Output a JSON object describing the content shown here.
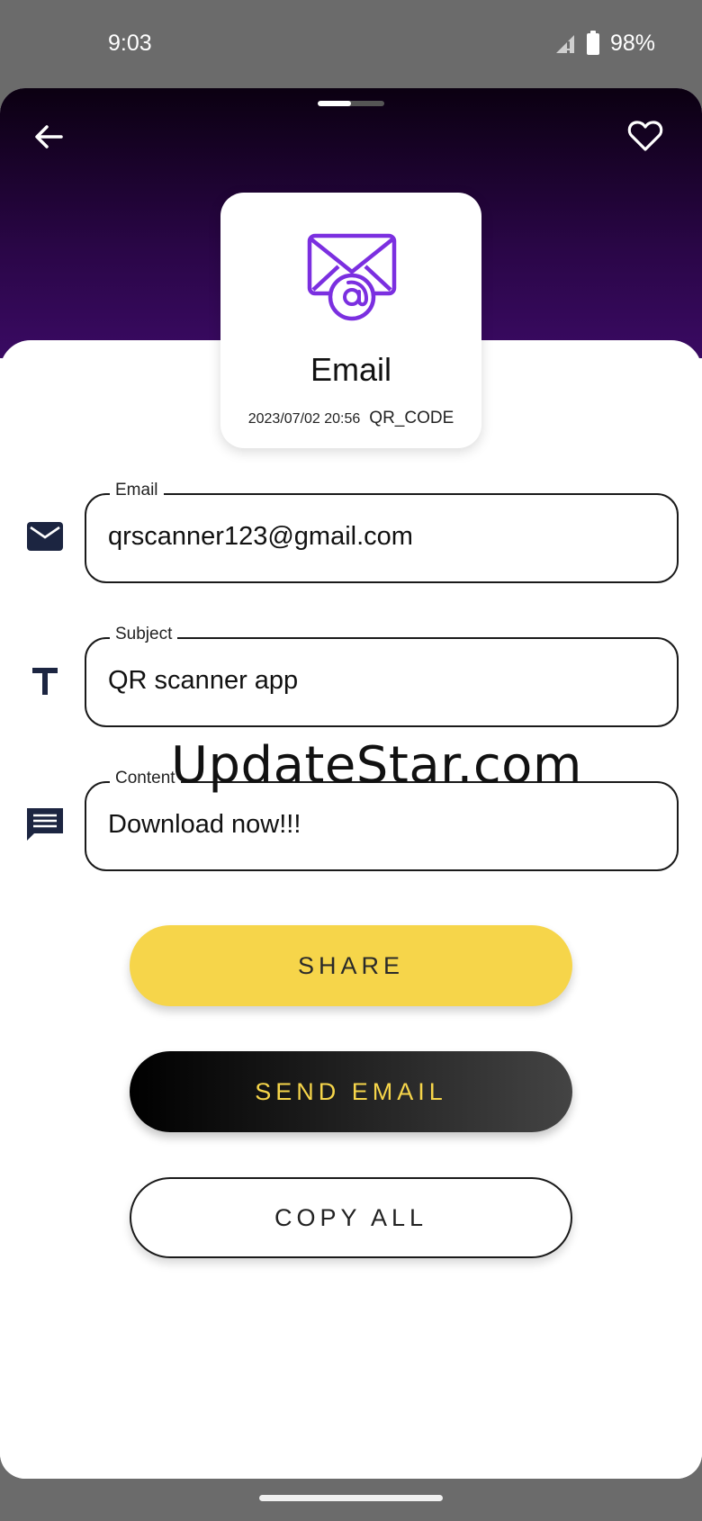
{
  "status_bar": {
    "time": "9:03",
    "battery": "98%"
  },
  "header": {
    "back_icon": "arrow-left-icon",
    "favorite_icon": "heart-outline-icon"
  },
  "type_card": {
    "icon": "email-at-icon",
    "title": "Email",
    "date": "2023/07/02 20:56",
    "format": "QR_CODE",
    "accent": "#7b2fe0"
  },
  "fields": {
    "email": {
      "label": "Email",
      "value": "qrscanner123@gmail.com",
      "icon": "envelope-icon"
    },
    "subject": {
      "label": "Subject",
      "value": "QR scanner app",
      "icon": "text-t-icon"
    },
    "content": {
      "label": "Content",
      "value": "Download now!!!",
      "icon": "message-icon"
    }
  },
  "watermark": "UpdateStar.com",
  "actions": {
    "share": "SHARE",
    "send_email": "SEND EMAIL",
    "copy_all": "COPY ALL"
  },
  "colors": {
    "share_bg": "#f6d54a",
    "send_text": "#f6d54a",
    "hero_dark": "#0b0011",
    "hero_purple": "#3a0a63"
  }
}
